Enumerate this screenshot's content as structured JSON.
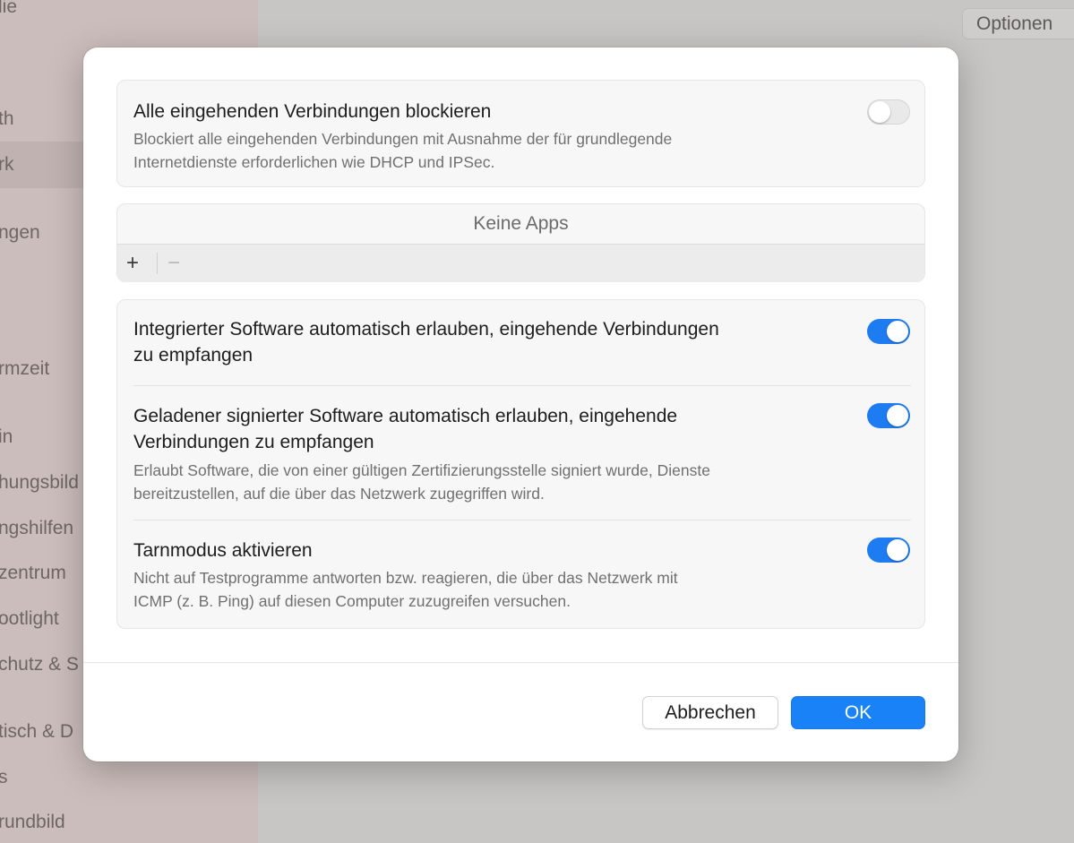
{
  "background": {
    "sidebar_items": [
      "lie",
      "th",
      "rk",
      "ngen",
      "rmzeit",
      "in",
      "hungsbild",
      "ngshilfen",
      "zentrum",
      "ootlight",
      "chutz & S",
      "tisch & D",
      "s",
      "rundbild"
    ],
    "options_label": "Optionen"
  },
  "sheet": {
    "block_all": {
      "title": "Alle eingehenden Verbindungen blockieren",
      "desc_line1": "Blockiert alle eingehenden Verbindungen mit Ausnahme der für grundlegende",
      "desc_line2": "Internetdienste erforderlichen wie DHCP und IPSec.",
      "toggle_on": false
    },
    "apps": {
      "empty_label": "Keine Apps",
      "add_label": "+",
      "remove_label": "−"
    },
    "builtin": {
      "title_line1": "Integrierter Software automatisch erlauben, eingehende Verbindungen",
      "title_line2": "zu empfangen",
      "toggle_on": true
    },
    "signed": {
      "title_line1": "Geladener signierter Software automatisch erlauben, eingehende",
      "title_line2": "Verbindungen zu empfangen",
      "desc_line1": "Erlaubt Software, die von einer gültigen Zertifizierungsstelle signiert wurde, Dienste",
      "desc_line2": "bereitzustellen, auf die über das Netzwerk zugegriffen wird.",
      "toggle_on": true
    },
    "stealth": {
      "title": "Tarnmodus aktivieren",
      "desc_line1": "Nicht auf Testprogramme antworten bzw. reagieren, die über das Netzwerk mit",
      "desc_line2": "ICMP (z. B. Ping) auf diesen Computer zuzugreifen versuchen.",
      "toggle_on": true
    },
    "cancel_label": "Abbrechen",
    "ok_label": "OK"
  },
  "colors": {
    "accent": "#1a82f7",
    "toggle_on": "#1e7cf2"
  }
}
